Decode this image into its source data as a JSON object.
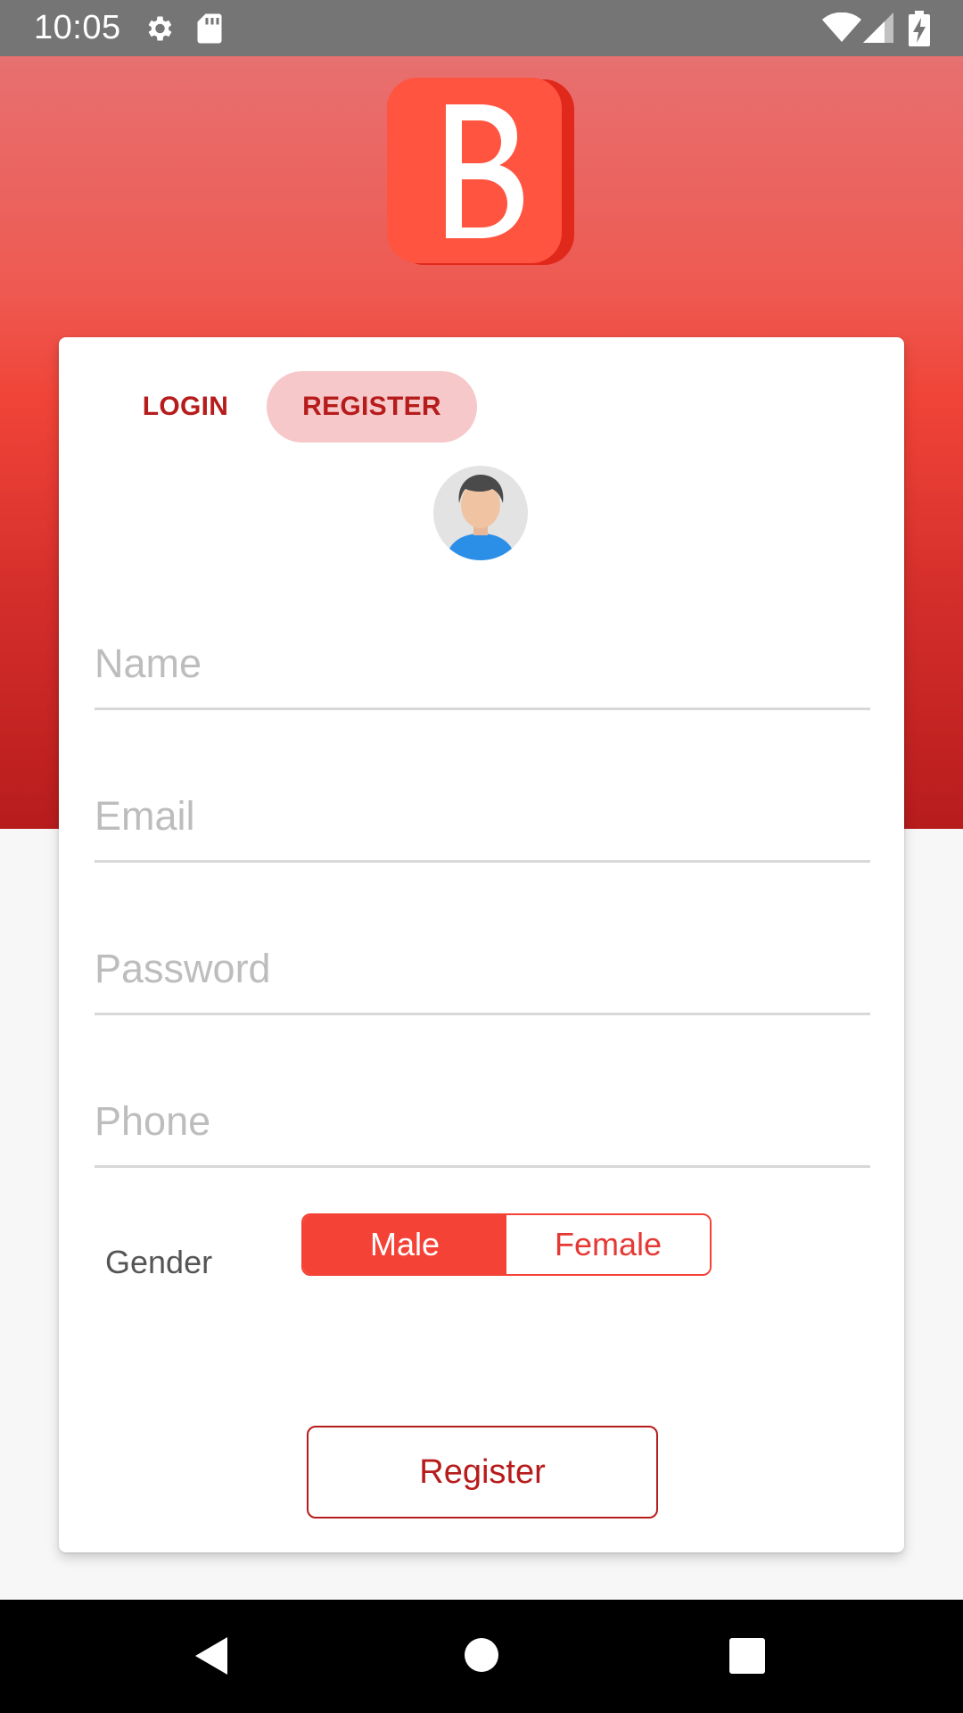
{
  "status_bar": {
    "time": "10:05",
    "icons": [
      "settings-icon",
      "sd-card-icon",
      "wifi-icon",
      "signal-icon",
      "battery-charging-icon"
    ]
  },
  "logo": {
    "letter": "B",
    "color": "#ff5440"
  },
  "tabs": {
    "login_label": "LOGIN",
    "register_label": "REGISTER",
    "active": "REGISTER"
  },
  "avatar": {
    "icon": "user-avatar-icon"
  },
  "form": {
    "name_placeholder": "Name",
    "email_placeholder": "Email",
    "password_placeholder": "Password",
    "phone_placeholder": "Phone",
    "gender_label": "Gender",
    "gender_options": [
      "Male",
      "Female"
    ],
    "gender_selected": "Male",
    "submit_label": "Register"
  },
  "colors": {
    "accent": "#f44336",
    "dark_accent": "#b71c1c",
    "tab_highlight": "#f6c8c9"
  },
  "nav_bar": {
    "icons": [
      "back-icon",
      "home-icon",
      "recents-icon"
    ]
  }
}
